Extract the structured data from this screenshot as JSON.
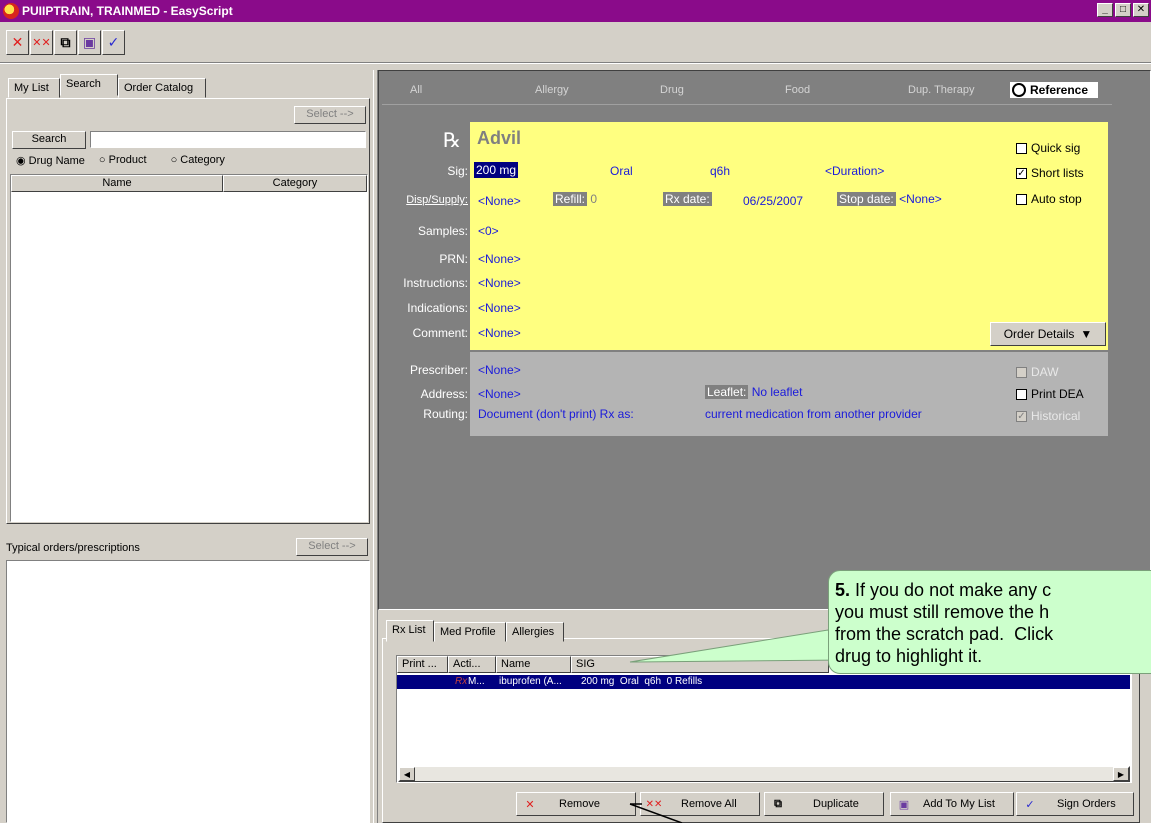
{
  "window": {
    "title": "PUIIPTRAIN, TRAINMED - EasyScript",
    "min": "_",
    "max": "□",
    "close": "✕"
  },
  "toolbar": {
    "icons": [
      "remove-icon",
      "remove-all-icon",
      "duplicate-icon",
      "add-to-list-icon",
      "sign-orders-icon"
    ]
  },
  "left_tabs": [
    "My List",
    "Search",
    "Order Catalog"
  ],
  "left": {
    "select_label": "Select -->",
    "search_label": "Search",
    "search_value": "",
    "radio_options": [
      "Drug Name",
      "Product",
      "Category"
    ],
    "columns": [
      "Name",
      "Category"
    ],
    "typical_label": "Typical orders/prescriptions",
    "typical_select_label": "Select -->"
  },
  "filters": [
    "All",
    "Allergy",
    "Drug",
    "Food",
    "Dup. Therapy"
  ],
  "reference_label": "Reference",
  "rx": {
    "drug": "Advil",
    "sig_label": "Sig:",
    "dose": "200 mg",
    "route": "Oral",
    "frequency": "q6h",
    "duration": "<Duration>",
    "disp_label": "Disp/Supply:",
    "disp_value": "<None>",
    "refill_label": "Refill:",
    "refill_value": "0",
    "rxdate_label": "Rx date:",
    "rxdate_value": "06/25/2007",
    "stopdate_label": "Stop date:",
    "stopdate_value": "<None>",
    "samples_label": "Samples:",
    "samples_value": "<0>",
    "prn_label": "PRN:",
    "prn_value": "<None>",
    "instructions_label": "Instructions:",
    "instructions_value": "<None>",
    "indications_label": "Indications:",
    "indications_value": "<None>",
    "comment_label": "Comment:",
    "comment_value": "<None>",
    "quick_sig": "Quick sig",
    "short_lists": "Short lists",
    "auto_stop": "Auto stop",
    "order_details": "Order Details"
  },
  "prescriber": {
    "prescriber_label": "Prescriber:",
    "prescriber_value": "<None>",
    "address_label": "Address:",
    "address_value": "<None>",
    "routing_label": "Routing:",
    "routing_value": "Document (don't print) Rx as:",
    "leaflet_label": "Leaflet:",
    "leaflet_value": "No leaflet",
    "routing_detail": "current medication from another provider",
    "daw": "DAW",
    "print_dea": "Print DEA",
    "historical": "Historical"
  },
  "bottom_tabs": [
    "Rx List",
    "Med Profile",
    "Allergies"
  ],
  "rxlist": {
    "columns": [
      "Print ...",
      "Acti...",
      "Name",
      "SIG"
    ],
    "row": {
      "print": "Rx",
      "action": "M...",
      "name": "ibuprofen (A...",
      "sig": "200 mg  Oral  q6h  0 Refills"
    }
  },
  "actions": {
    "remove": "Remove",
    "remove_all": "Remove All",
    "duplicate": "Duplicate",
    "add_to_my_list": "Add To My List",
    "sign_orders": "Sign Orders"
  },
  "callout": {
    "step": "5.",
    "line1": " If you do not make any c",
    "line2": "you must still remove the h",
    "line3": "from the scratch pad.  Click",
    "line4": "drug to highlight it."
  },
  "colors": {
    "title_bg": "#8a0b8a",
    "rx_panel": "#ffff80",
    "dark_panel": "#808080",
    "value_blue": "#1a1adb",
    "selected_row": "#000080",
    "callout_bg": "#ccffcc"
  }
}
